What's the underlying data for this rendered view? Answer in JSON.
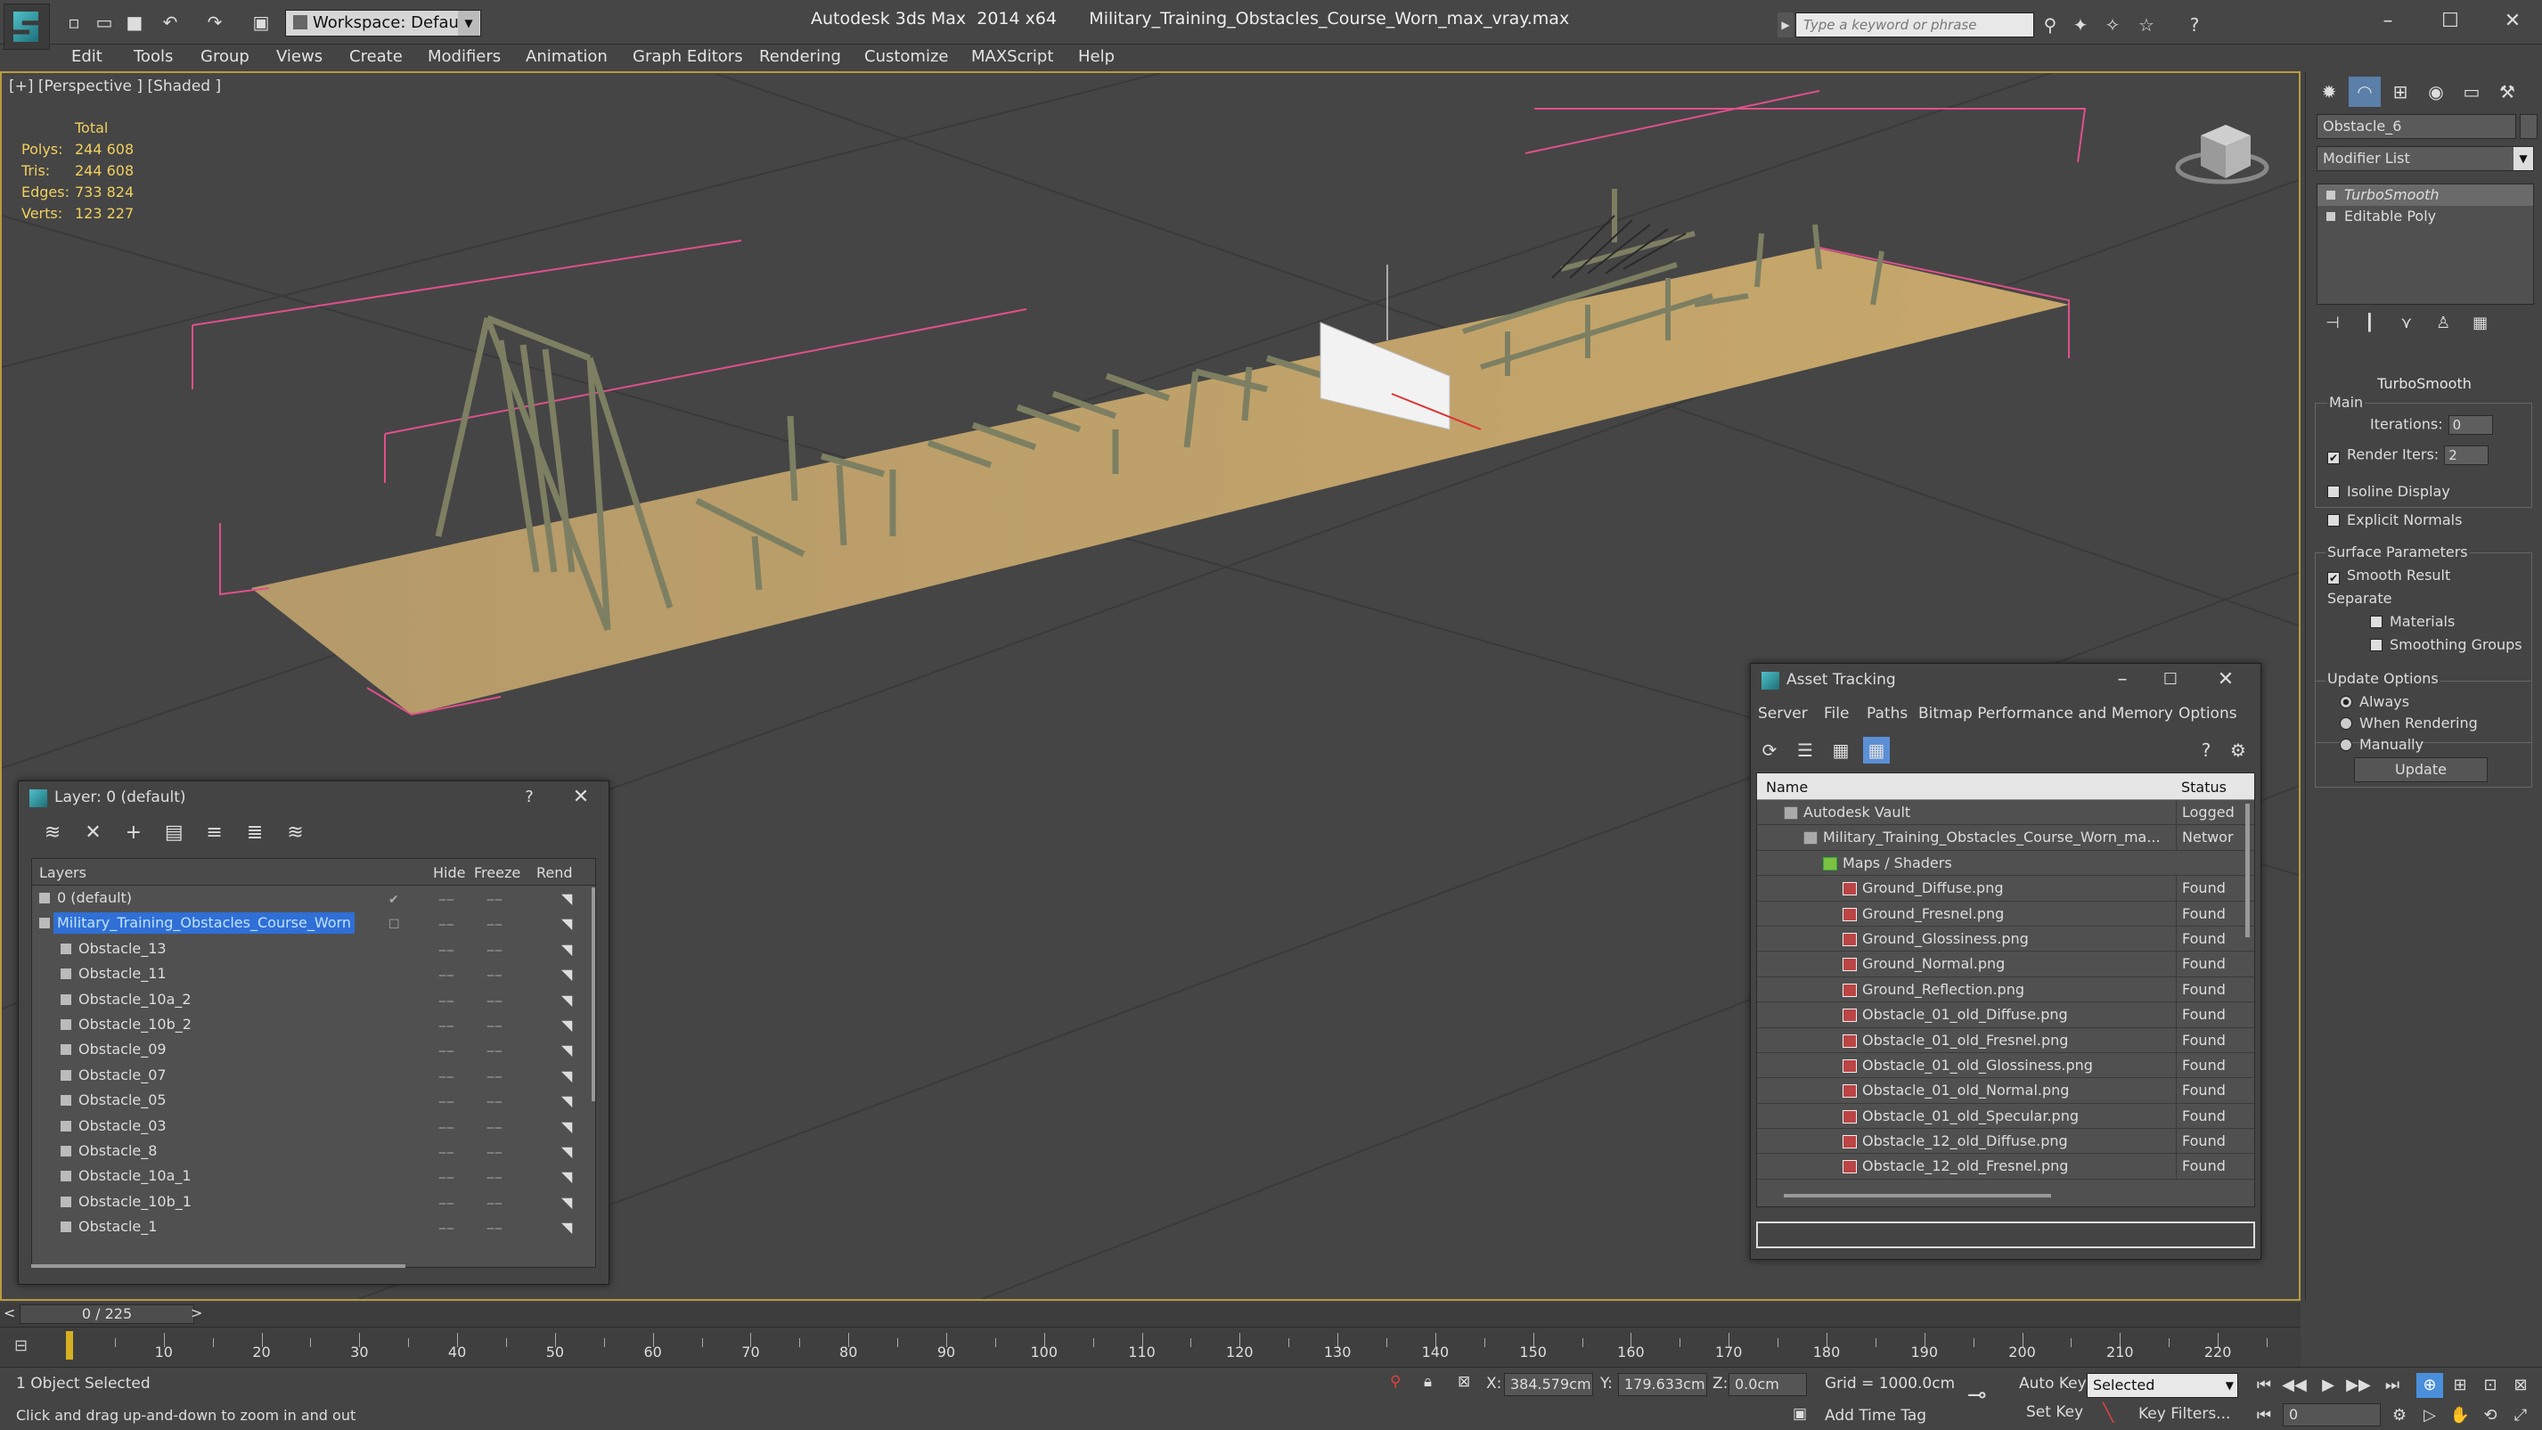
{
  "titlebar": {
    "workspace_label": "Workspace: Default",
    "window_title": "Autodesk 3ds Max  2014 x64      Military_Training_Obstacles_Course_Worn_max_vray.max",
    "search_placeholder": "Type a keyword or phrase"
  },
  "menu": [
    "Edit",
    "Tools",
    "Group",
    "Views",
    "Create",
    "Modifiers",
    "Animation",
    "Graph Editors",
    "Rendering",
    "Customize",
    "MAXScript",
    "Help"
  ],
  "viewport": {
    "label": "[+] [Perspective ] [Shaded ]",
    "stats": {
      "header": "Total",
      "rows": [
        {
          "label": "Polys:",
          "value": "244 608"
        },
        {
          "label": "Tris:",
          "value": "244 608"
        },
        {
          "label": "Edges:",
          "value": "733 824"
        },
        {
          "label": "Verts:",
          "value": "123 227"
        }
      ]
    }
  },
  "command_panel": {
    "object_name": "Obstacle_6",
    "modifier_list": "Modifier List",
    "stack": [
      "TurboSmooth",
      "Editable Poly"
    ],
    "rollout_title": "TurboSmooth",
    "main_label": "Main",
    "iterations_label": "Iterations:",
    "iterations_value": "0",
    "render_iters_label": "Render Iters:",
    "render_iters_value": "2",
    "isoline_label": "Isoline Display",
    "explicit_normals_label": "Explicit Normals",
    "surface_params_label": "Surface Parameters",
    "smooth_result_label": "Smooth Result",
    "separate_label": "Separate",
    "materials_label": "Materials",
    "smoothing_groups_label": "Smoothing Groups",
    "update_options_label": "Update Options",
    "always_label": "Always",
    "when_rendering_label": "When Rendering",
    "manually_label": "Manually",
    "update_button": "Update"
  },
  "layer_window": {
    "title": "Layer: 0 (default)",
    "help": "?",
    "columns": {
      "layers": "Layers",
      "hide": "Hide",
      "freeze": "Freeze",
      "render": "Rend"
    },
    "rows": [
      {
        "name": "0 (default)",
        "indent": 0
      },
      {
        "name": "Military_Training_Obstacles_Course_Worn",
        "indent": 0,
        "selected": true
      },
      {
        "name": "Obstacle_13",
        "indent": 1
      },
      {
        "name": "Obstacle_11",
        "indent": 1
      },
      {
        "name": "Obstacle_10a_2",
        "indent": 1
      },
      {
        "name": "Obstacle_10b_2",
        "indent": 1
      },
      {
        "name": "Obstacle_09",
        "indent": 1
      },
      {
        "name": "Obstacle_07",
        "indent": 1
      },
      {
        "name": "Obstacle_05",
        "indent": 1
      },
      {
        "name": "Obstacle_03",
        "indent": 1
      },
      {
        "name": "Obstacle_8",
        "indent": 1
      },
      {
        "name": "Obstacle_10a_1",
        "indent": 1
      },
      {
        "name": "Obstacle_10b_1",
        "indent": 1
      },
      {
        "name": "Obstacle_1",
        "indent": 1
      }
    ]
  },
  "asset_window": {
    "title": "Asset Tracking",
    "menu": [
      "Server",
      "File",
      "Paths",
      "Bitmap Performance and Memory",
      "Options"
    ],
    "columns": {
      "name": "Name",
      "status": "Status"
    },
    "rows": [
      {
        "name": "Autodesk Vault",
        "status": "Logged",
        "indent": 1,
        "kind": "vault"
      },
      {
        "name": "Military_Training_Obstacles_Course_Worn_ma...",
        "status": "Networ",
        "indent": 2,
        "kind": "vault"
      },
      {
        "name": "Maps / Shaders",
        "status": "",
        "indent": 3,
        "kind": "folder"
      },
      {
        "name": "Ground_Diffuse.png",
        "status": "Found",
        "indent": 4,
        "kind": "png"
      },
      {
        "name": "Ground_Fresnel.png",
        "status": "Found",
        "indent": 4,
        "kind": "png"
      },
      {
        "name": "Ground_Glossiness.png",
        "status": "Found",
        "indent": 4,
        "kind": "png"
      },
      {
        "name": "Ground_Normal.png",
        "status": "Found",
        "indent": 4,
        "kind": "png"
      },
      {
        "name": "Ground_Reflection.png",
        "status": "Found",
        "indent": 4,
        "kind": "png"
      },
      {
        "name": "Obstacle_01_old_Diffuse.png",
        "status": "Found",
        "indent": 4,
        "kind": "png"
      },
      {
        "name": "Obstacle_01_old_Fresnel.png",
        "status": "Found",
        "indent": 4,
        "kind": "png"
      },
      {
        "name": "Obstacle_01_old_Glossiness.png",
        "status": "Found",
        "indent": 4,
        "kind": "png"
      },
      {
        "name": "Obstacle_01_old_Normal.png",
        "status": "Found",
        "indent": 4,
        "kind": "png"
      },
      {
        "name": "Obstacle_01_old_Specular.png",
        "status": "Found",
        "indent": 4,
        "kind": "png"
      },
      {
        "name": "Obstacle_12_old_Diffuse.png",
        "status": "Found",
        "indent": 4,
        "kind": "png"
      },
      {
        "name": "Obstacle_12_old_Fresnel.png",
        "status": "Found",
        "indent": 4,
        "kind": "png"
      }
    ]
  },
  "timeline": {
    "slider_label": "0 / 225",
    "prev": "<",
    "next": ">",
    "ticks": [
      "10",
      "20",
      "30",
      "40",
      "50",
      "60",
      "70",
      "80",
      "90",
      "100",
      "110",
      "120",
      "130",
      "140",
      "150",
      "160",
      "170",
      "180",
      "190",
      "200",
      "210",
      "220"
    ]
  },
  "status": {
    "selection": "1 Object Selected",
    "prompt": "Click and drag up-and-down to zoom in and out",
    "x_label": "X:",
    "x_value": "384.579cm",
    "y_label": "Y:",
    "y_value": "179.633cm",
    "z_label": "Z:",
    "z_value": "0.0cm",
    "grid": "Grid = 1000.0cm",
    "add_time_tag": "Add Time Tag",
    "auto_key": "Auto Key",
    "set_key": "Set Key",
    "selected_dropdown": "Selected",
    "key_filters": "Key Filters...",
    "frame_value": "0"
  }
}
